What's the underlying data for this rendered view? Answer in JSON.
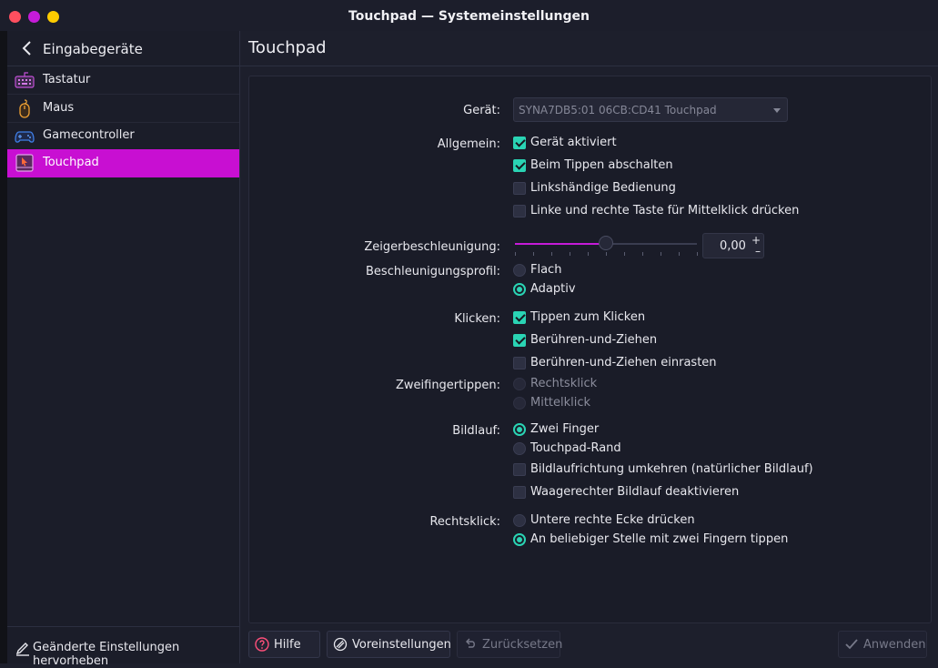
{
  "window": {
    "title": "Touchpad — Systemeinstellungen"
  },
  "sidebar": {
    "back_label": "Eingabegeräte",
    "items": [
      {
        "label": "Tastatur",
        "icon": "keyboard-icon"
      },
      {
        "label": "Maus",
        "icon": "mouse-icon"
      },
      {
        "label": "Gamecontroller",
        "icon": "gamepad-icon"
      },
      {
        "label": "Touchpad",
        "icon": "touchpad-icon",
        "active": true
      }
    ],
    "footer_label": "Geänderte Einstellungen hervorheben"
  },
  "main": {
    "title": "Touchpad",
    "device": {
      "label": "Gerät:",
      "value": "SYNA7DB5:01 06CB:CD41 Touchpad"
    },
    "general": {
      "label": "Allgemein:",
      "options": [
        {
          "label": "Gerät aktiviert",
          "checked": true
        },
        {
          "label": "Beim Tippen abschalten",
          "checked": true
        },
        {
          "label": "Linkshändige Bedienung",
          "checked": false
        },
        {
          "label": "Linke und rechte Taste für Mittelklick drücken",
          "checked": false
        }
      ]
    },
    "pointer_accel": {
      "label": "Zeigerbeschleunigung:",
      "value": "0,00",
      "slider_fraction": 0.5,
      "plus": "+",
      "minus": "–"
    },
    "accel_profile": {
      "label": "Beschleunigungsprofil:",
      "options": [
        {
          "label": "Flach",
          "selected": false
        },
        {
          "label": "Adaptiv",
          "selected": true
        }
      ]
    },
    "clicking": {
      "label": "Klicken:",
      "options": [
        {
          "label": "Tippen zum Klicken",
          "checked": true
        },
        {
          "label": "Berühren-und-Ziehen",
          "checked": true
        },
        {
          "label": "Berühren-und-Ziehen einrasten",
          "checked": false
        }
      ]
    },
    "two_finger_tap": {
      "label": "Zweifingertippen:",
      "options": [
        {
          "label": "Rechtsklick",
          "selected": false,
          "disabled": true
        },
        {
          "label": "Mittelklick",
          "selected": false,
          "disabled": true
        }
      ]
    },
    "scrolling": {
      "label": "Bildlauf:",
      "radios": [
        {
          "label": "Zwei Finger",
          "selected": true
        },
        {
          "label": "Touchpad-Rand",
          "selected": false
        }
      ],
      "checks": [
        {
          "label": "Bildlaufrichtung umkehren (natürlicher Bildlauf)",
          "checked": false
        },
        {
          "label": "Waagerechter Bildlauf deaktivieren",
          "checked": false
        }
      ]
    },
    "right_click": {
      "label": "Rechtsklick:",
      "options": [
        {
          "label": "Untere rechte Ecke drücken",
          "selected": false
        },
        {
          "label": "An beliebiger Stelle mit zwei Fingern tippen",
          "selected": true
        }
      ]
    }
  },
  "buttons": {
    "help": "Hilfe",
    "defaults": "Voreinstellungen",
    "reset": "Zurücksetzen",
    "apply": "Anwenden"
  },
  "colors": {
    "accent": "#c80fd2",
    "check": "#2ad4b4",
    "background": "#1d1f2c"
  }
}
